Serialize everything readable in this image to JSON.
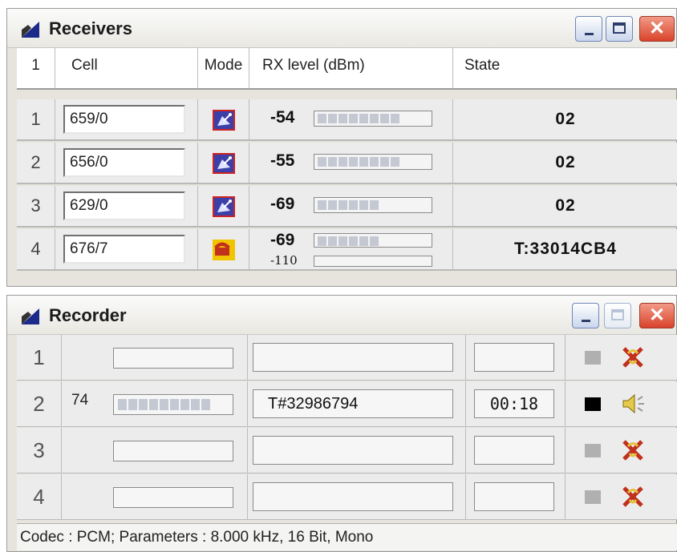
{
  "receivers": {
    "title": "Receivers",
    "headers": {
      "num": "1",
      "cell": "Cell",
      "mode": "Mode",
      "rx": "RX level  (dBm)",
      "state": "State"
    },
    "rows": [
      {
        "num": "1",
        "cell": "659/0",
        "mode_icon": "satellite-icon",
        "rx": "-54",
        "level_segments": 8,
        "state": "02"
      },
      {
        "num": "2",
        "cell": "656/0",
        "mode_icon": "satellite-icon",
        "rx": "-55",
        "level_segments": 8,
        "state": "02"
      },
      {
        "num": "3",
        "cell": "629/0",
        "mode_icon": "satellite-icon",
        "rx": "-69",
        "level_segments": 6,
        "state": "02"
      },
      {
        "num": "4",
        "cell": "676/7",
        "mode_icon": "phone-icon",
        "rx": "-69",
        "rx_sub": "-110",
        "level_segments": 6,
        "state": "T:33014CB4"
      }
    ]
  },
  "recorder": {
    "title": "Recorder",
    "rows": [
      {
        "num": "1",
        "level": "",
        "level_segments": 0,
        "text": "",
        "time": "",
        "active": false,
        "action_icon": "disabled-x-icon"
      },
      {
        "num": "2",
        "level": "74",
        "level_segments": 9,
        "text": "T#32986794",
        "time": "00:18",
        "active": true,
        "action_icon": "speaker-icon"
      },
      {
        "num": "3",
        "level": "",
        "level_segments": 0,
        "text": "",
        "time": "",
        "active": false,
        "action_icon": "disabled-x-icon"
      },
      {
        "num": "4",
        "level": "",
        "level_segments": 0,
        "text": "",
        "time": "",
        "active": false,
        "action_icon": "disabled-x-icon"
      }
    ],
    "status": "Codec : PCM; Parameters : 8.000 kHz, 16 Bit, Mono"
  },
  "colors": {
    "accent": "#3c3fa8",
    "close": "#d9432b",
    "segment": "#c4c8d2"
  }
}
